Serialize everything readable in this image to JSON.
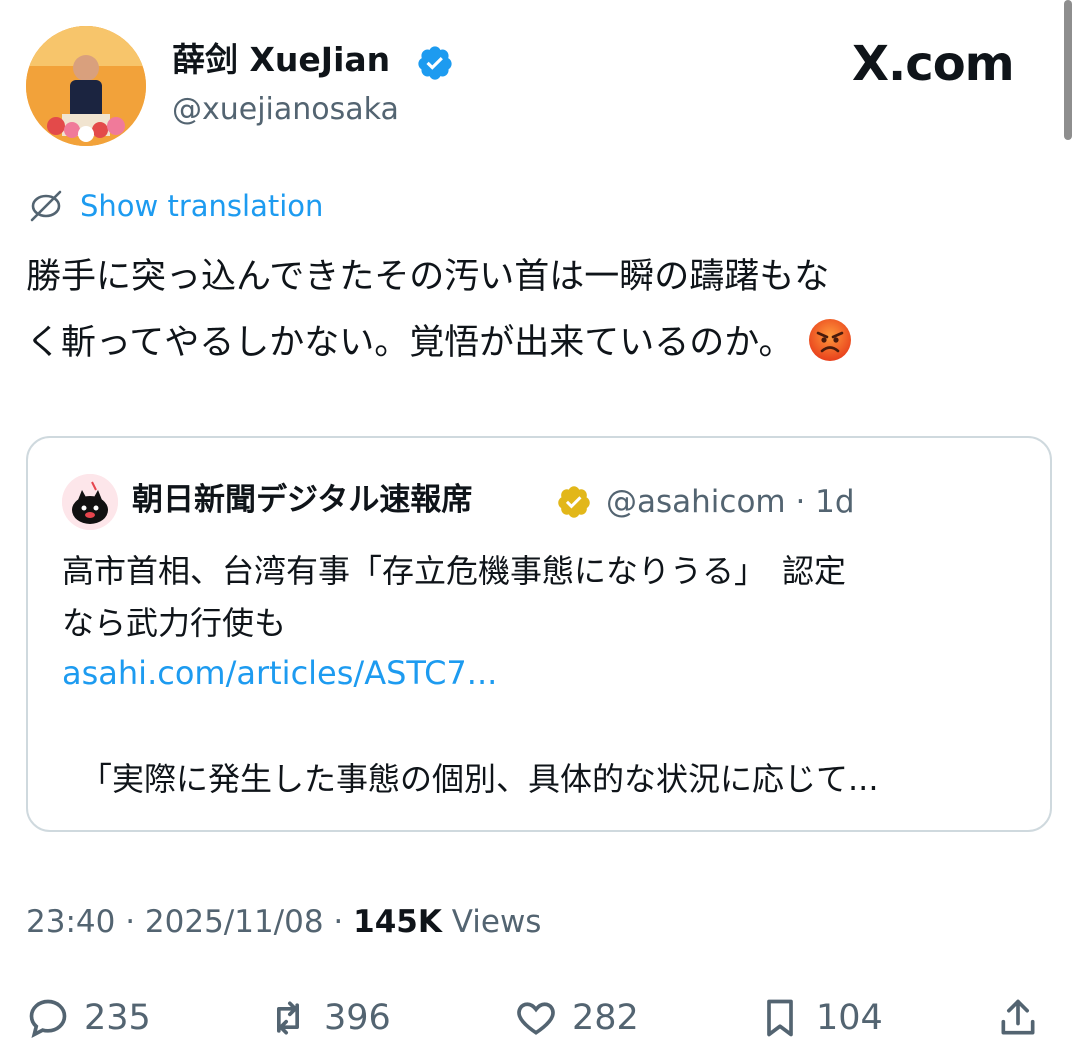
{
  "author": {
    "display_name": "薛剑 XueJian",
    "handle": "@xuejianosaka"
  },
  "site_label": "X.com",
  "translate_link": "Show translation",
  "tweet": {
    "line1": "勝手に突っ込んできたその汚い首は一瞬の躊躇もな",
    "line2": "く斬ってやるしかない。覚悟が出来ているのか。",
    "emoji": "angry-face-icon"
  },
  "quote": {
    "name": "朝日新聞デジタル速報席",
    "meta": "@asahicom · 1d",
    "line1": "高市首相、台湾有事「存立危機事態になりうる」　認定",
    "line2": "なら武力行使も",
    "link": "asahi.com/articles/ASTC7...",
    "line3": "「実際に発生した事態の個別、具体的な状況に応じて..."
  },
  "timestamp": {
    "time_date": "23:40 · 2025/11/08 · ",
    "views_count": "145K",
    "views_label": " Views"
  },
  "actions": {
    "replies": "235",
    "reposts": "396",
    "likes": "282",
    "bookmarks": "104"
  },
  "colors": {
    "accent": "#1d9bf0",
    "verified_blue": "#1d9bf0",
    "verified_gold": "#e2b719",
    "secondary_text": "#536471",
    "border": "#cfd9de"
  }
}
